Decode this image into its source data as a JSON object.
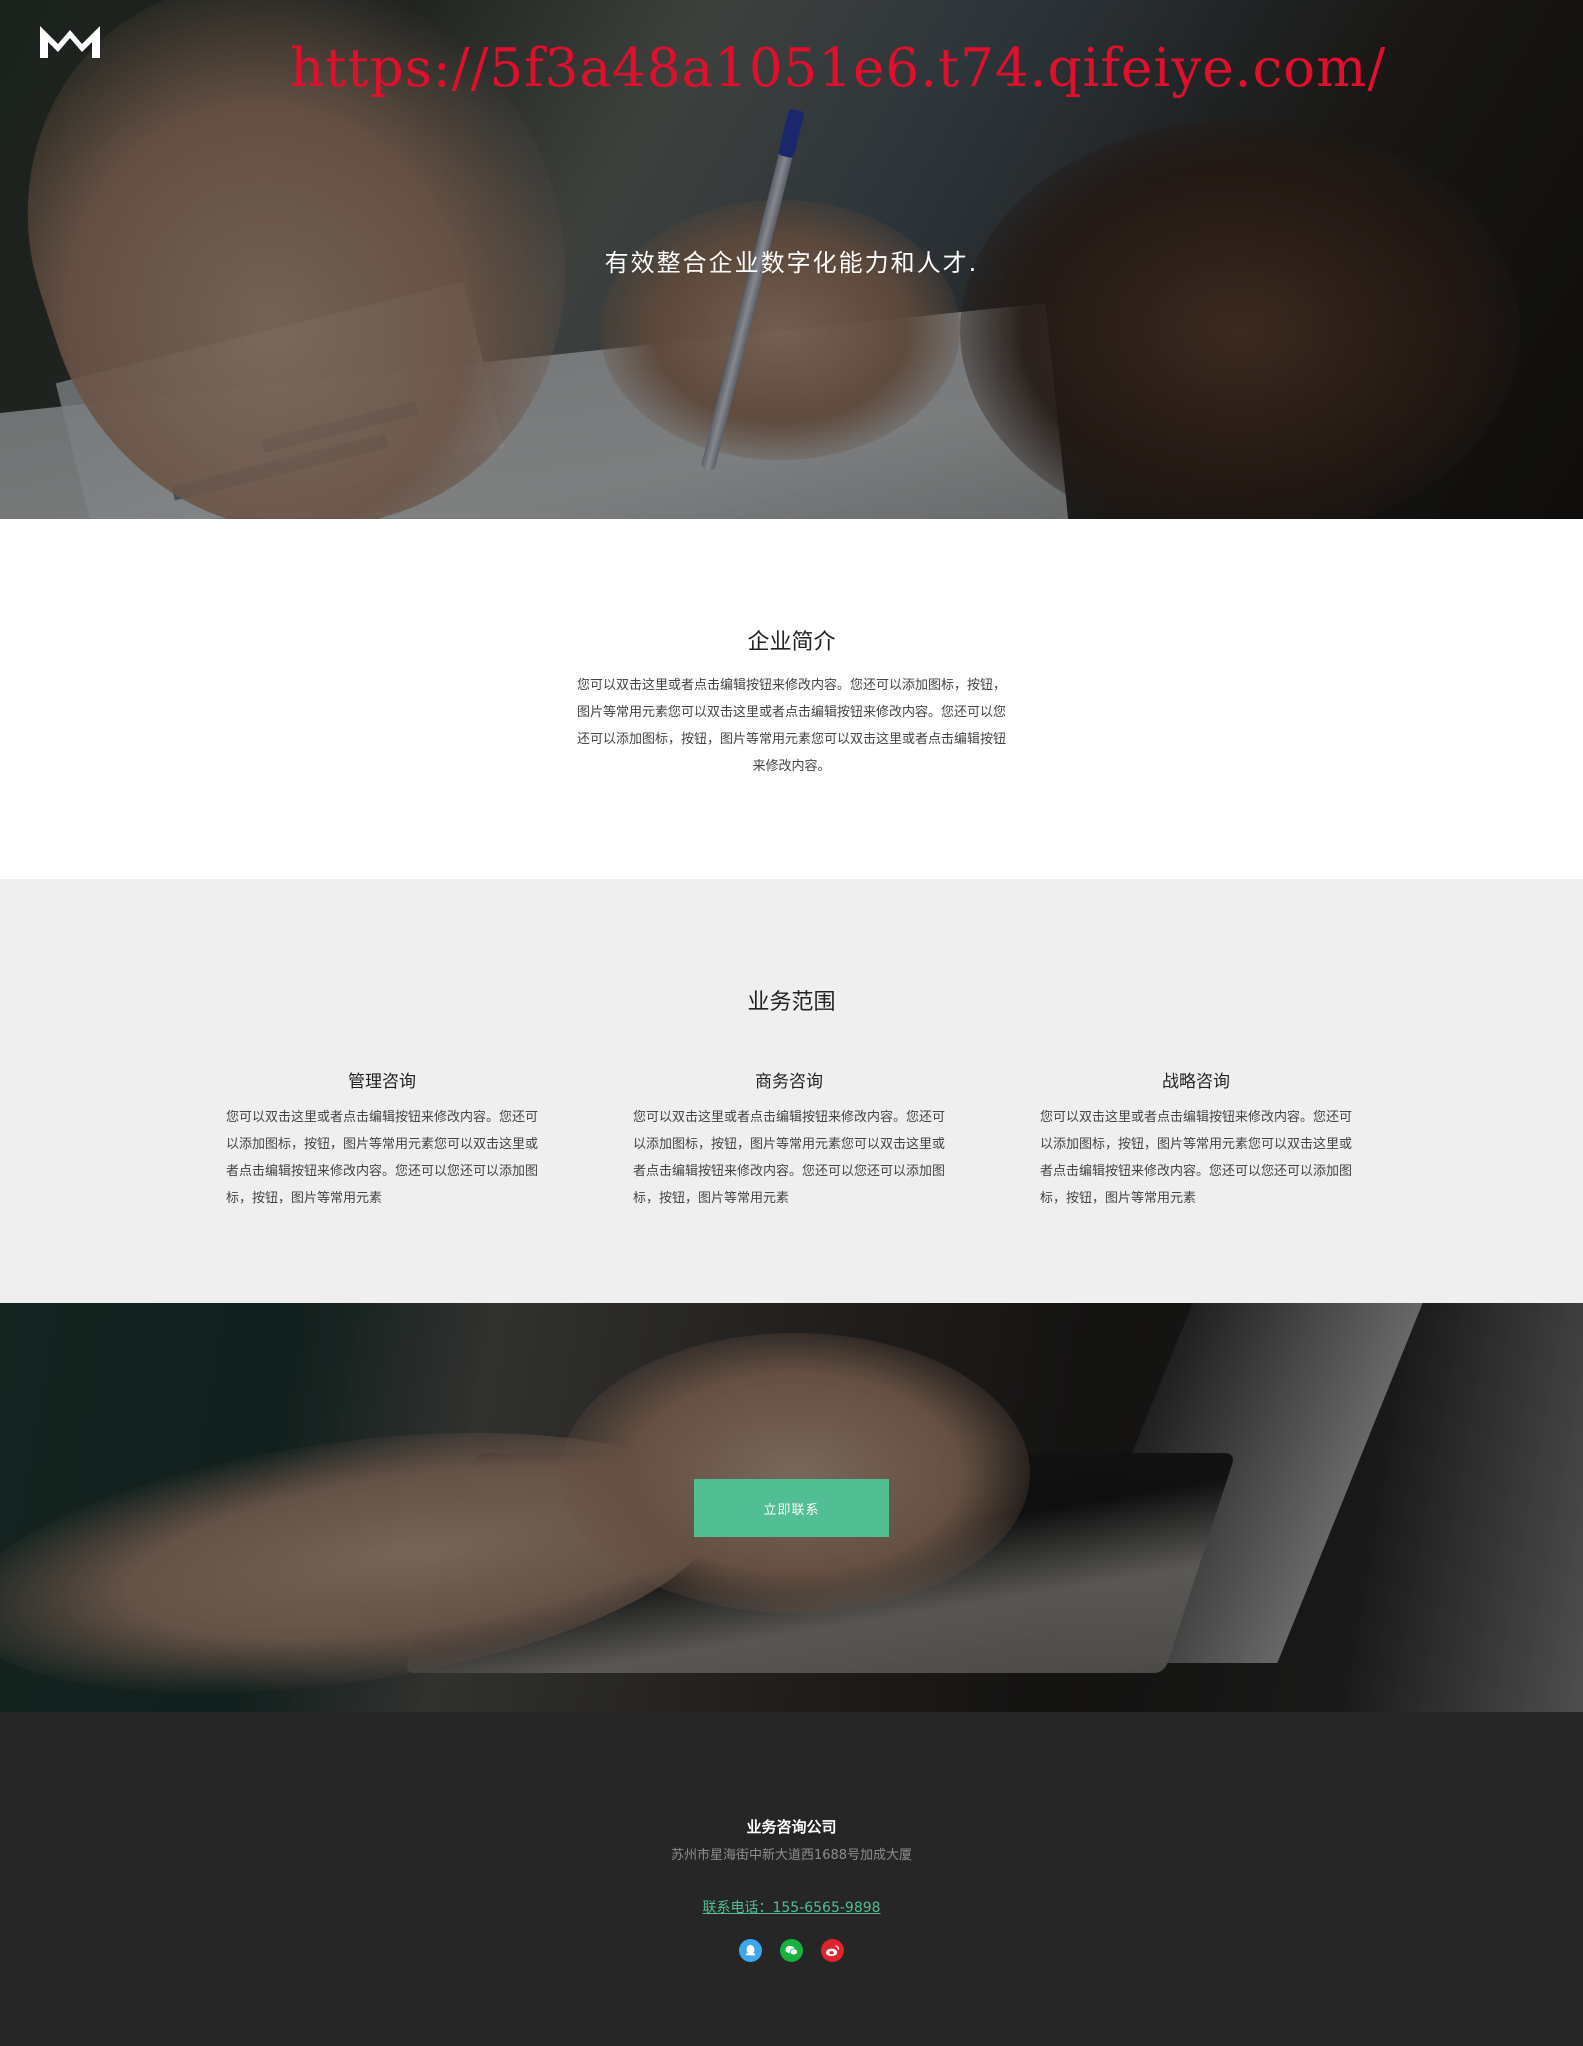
{
  "hero": {
    "url_overlay": "https://5f3a48a1051e6.t74.qifeiye.com/",
    "tagline": "有效整合企业数字化能力和人才."
  },
  "intro": {
    "title": "企业简介",
    "text": "您可以双击这里或者点击编辑按钮来修改内容。您还可以添加图标，按钮，图片等常用元素您可以双击这里或者点击编辑按钮来修改内容。您还可以您还可以添加图标，按钮，图片等常用元素您可以双击这里或者点击编辑按钮来修改内容。"
  },
  "services": {
    "title": "业务范围",
    "items": [
      {
        "title": "管理咨询",
        "text": "您可以双击这里或者点击编辑按钮来修改内容。您还可以添加图标，按钮，图片等常用元素您可以双击这里或者点击编辑按钮来修改内容。您还可以您还可以添加图标，按钮，图片等常用元素"
      },
      {
        "title": "商务咨询",
        "text": "您可以双击这里或者点击编辑按钮来修改内容。您还可以添加图标，按钮，图片等常用元素您可以双击这里或者点击编辑按钮来修改内容。您还可以您还可以添加图标，按钮，图片等常用元素"
      },
      {
        "title": "战略咨询",
        "text": "您可以双击这里或者点击编辑按钮来修改内容。您还可以添加图标，按钮，图片等常用元素您可以双击这里或者点击编辑按钮来修改内容。您还可以您还可以添加图标，按钮，图片等常用元素"
      }
    ]
  },
  "cta": {
    "button_label": "立即联系",
    "button_color": "#52be93"
  },
  "footer": {
    "company": "业务咨询公司",
    "address": "苏州市星海街中新大道西1688号加成大厦",
    "phone": "联系电话：155-6565-9898",
    "social": [
      {
        "icon": "qq-icon",
        "color": "#3ea6ed"
      },
      {
        "icon": "wechat-icon",
        "color": "#16b23c"
      },
      {
        "icon": "weibo-icon",
        "color": "#e0242b"
      }
    ]
  }
}
